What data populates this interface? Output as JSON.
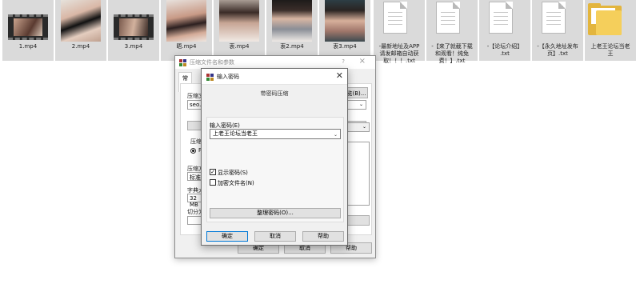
{
  "files": [
    {
      "name": "1.mp4",
      "kind": "video"
    },
    {
      "name": "2.mp4",
      "kind": "photo"
    },
    {
      "name": "3.mp4",
      "kind": "video"
    },
    {
      "name": "晤.mp4",
      "kind": "photo"
    },
    {
      "name": "衷.mp4",
      "kind": "photo"
    },
    {
      "name": "衷2.mp4",
      "kind": "photo"
    },
    {
      "name": "衷3.mp4",
      "kind": "photo"
    },
    {
      "name": "最新地址及APP请发邮箱自动获取！！！.txt",
      "kind": "text",
      "display": "-最新地址及APP\n请发邮箱自动获\n取！！！.txt"
    },
    {
      "name": "【来了就截下载和观看！纯免费！】.txt",
      "kind": "text",
      "display": "-【来了就截下载\n和观看！纯免\n费！】.txt"
    },
    {
      "name": "【论坛介绍】.txt",
      "kind": "text",
      "display": "-【论坛介绍】\n.txt"
    },
    {
      "name": "【永久地址发布页】.txt",
      "kind": "text",
      "display": "-【永久地址发布\n页】.txt"
    },
    {
      "name": "上老王论坛当老王",
      "kind": "folder",
      "display": "上老王论坛当老\n王"
    }
  ],
  "back_dialog": {
    "title": "压缩文件名和参数",
    "help_glyph": "?",
    "close_glyph": "×",
    "tab_general": "常规",
    "archive_name_label": "压缩文",
    "archive_name_value": "seo.ra",
    "browse_button": "浏览(B)...",
    "format_label": "压缩",
    "format_value": "RA",
    "method_label": "压缩方",
    "method_value": "标准",
    "dict_label": "字典大",
    "dict_value": "32 MB",
    "split_label": "切分为",
    "ok_button": "确定",
    "cancel_button": "取消",
    "help_button": "帮助"
  },
  "password_dialog": {
    "title": "输入密码",
    "subtitle": "带密码压缩",
    "password_label": "输入密码(E)",
    "password_value": "上老王论坛当老王",
    "show_password_label": "显示密码(S)",
    "show_password_checked": true,
    "show_password_check": "✓",
    "encrypt_filenames_label": "加密文件名(N)",
    "encrypt_filenames_checked": false,
    "organize_button": "整理密码(O)...",
    "ok_button": "确定",
    "cancel_button": "取消",
    "help_button": "帮助",
    "close_glyph": "✕"
  },
  "colors": {
    "selected_file": "#dadada",
    "default_button_border": "#0078d7",
    "folder": "#f5cf5b",
    "dialog_bg": "#f0f0f0"
  }
}
